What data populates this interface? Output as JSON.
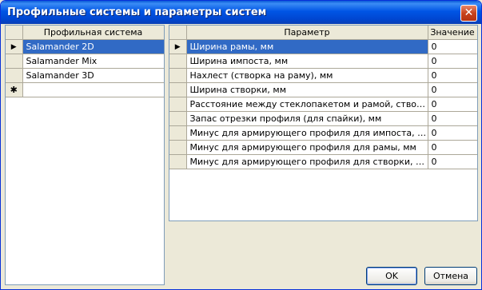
{
  "window": {
    "title": "Профильные системы и параметры систем",
    "close_glyph": "✕"
  },
  "systems_grid": {
    "header": "Профильная система",
    "rows": [
      {
        "marker": "▶",
        "name": "Salamander 2D",
        "selected": true
      },
      {
        "marker": "",
        "name": "Salamander Mix",
        "selected": false
      },
      {
        "marker": "",
        "name": "Salamander 3D",
        "selected": false
      }
    ],
    "new_row_marker": "✱"
  },
  "params_grid": {
    "header_param": "Параметр",
    "header_value": "Значение",
    "rows": [
      {
        "marker": "▶",
        "param": "Ширина рамы, мм",
        "value": "0",
        "selected": true
      },
      {
        "marker": "",
        "param": "Ширина импоста, мм",
        "value": "0",
        "selected": false
      },
      {
        "marker": "",
        "param": "Нахлест (створка на раму), мм",
        "value": "0",
        "selected": false
      },
      {
        "marker": "",
        "param": "Ширина створки, мм",
        "value": "0",
        "selected": false
      },
      {
        "marker": "",
        "param": "Расстояние между стеклопакетом и рамой, створкой, ...",
        "value": "0",
        "selected": false
      },
      {
        "marker": "",
        "param": "Запас отрезки профиля (для спайки), мм",
        "value": "0",
        "selected": false
      },
      {
        "marker": "",
        "param": "Минус для армирующего профиля для импоста, мм",
        "value": "0",
        "selected": false
      },
      {
        "marker": "",
        "param": "Минус для армирующего профиля для рамы, мм",
        "value": "0",
        "selected": false
      },
      {
        "marker": "",
        "param": "Минус для армирующего профиля для створки, мм",
        "value": "0",
        "selected": false
      }
    ]
  },
  "buttons": {
    "ok": "OK",
    "cancel": "Отмена"
  },
  "colors": {
    "selection": "#316ac5",
    "titlebar": "#0055e5",
    "face": "#ece9d8"
  }
}
